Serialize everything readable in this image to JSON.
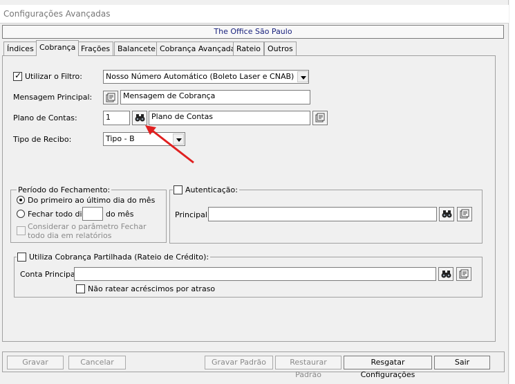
{
  "window": {
    "title": "Configurações Avançadas"
  },
  "header": {
    "company": "The Office São Paulo"
  },
  "tabs": [
    {
      "label": "Índices"
    },
    {
      "label": "Cobrança"
    },
    {
      "label": "Frações"
    },
    {
      "label": "Balancete"
    },
    {
      "label": "Cobrança Avançada"
    },
    {
      "label": "Rateio"
    },
    {
      "label": "Outros"
    }
  ],
  "cobranca": {
    "filtro_label": "Utilizar o Filtro:",
    "filtro_checked": true,
    "filtro_value": "Nosso Número Automático (Boleto Laser e CNAB)",
    "mensagem_label": "Mensagem Principal:",
    "mensagem_value": "Mensagem de Cobrança",
    "plano_label": "Plano de Contas:",
    "plano_code": "1",
    "plano_value": "Plano de Contas",
    "recibo_label": "Tipo de Recibo:",
    "recibo_value": "Tipo - B"
  },
  "periodo": {
    "title": "Período do Fechamento:",
    "option1": "Do primeiro ao último dia do mês",
    "option2_prefix": "Fechar todo dia",
    "option2_suffix": "do mês",
    "option2_value": "",
    "considerar": "Considerar o parâmetro Fechar todo dia em relatórios"
  },
  "autenticacao": {
    "title": "Autenticação:",
    "principal_label": "Principal:",
    "principal_value": ""
  },
  "partilhada": {
    "title": "Utiliza Cobrança Partilhada (Rateio de Crédito):",
    "conta_label": "Conta Principal:",
    "conta_value": "",
    "nao_ratear": "Não ratear acréscimos por atraso"
  },
  "buttons": {
    "gravar": "Gravar",
    "cancelar": "Cancelar",
    "gravar_padrao": "Gravar Padrão",
    "restaurar_padrao": "Restaurar Padrão",
    "resgatar": "Resgatar Configurações",
    "sair": "Sair"
  },
  "icons": {
    "binoculars": "binoculars-icon",
    "lookup": "lookup-form-icon"
  },
  "colors": {
    "header_text": "#1a237e",
    "annotation_arrow": "#e02020"
  }
}
